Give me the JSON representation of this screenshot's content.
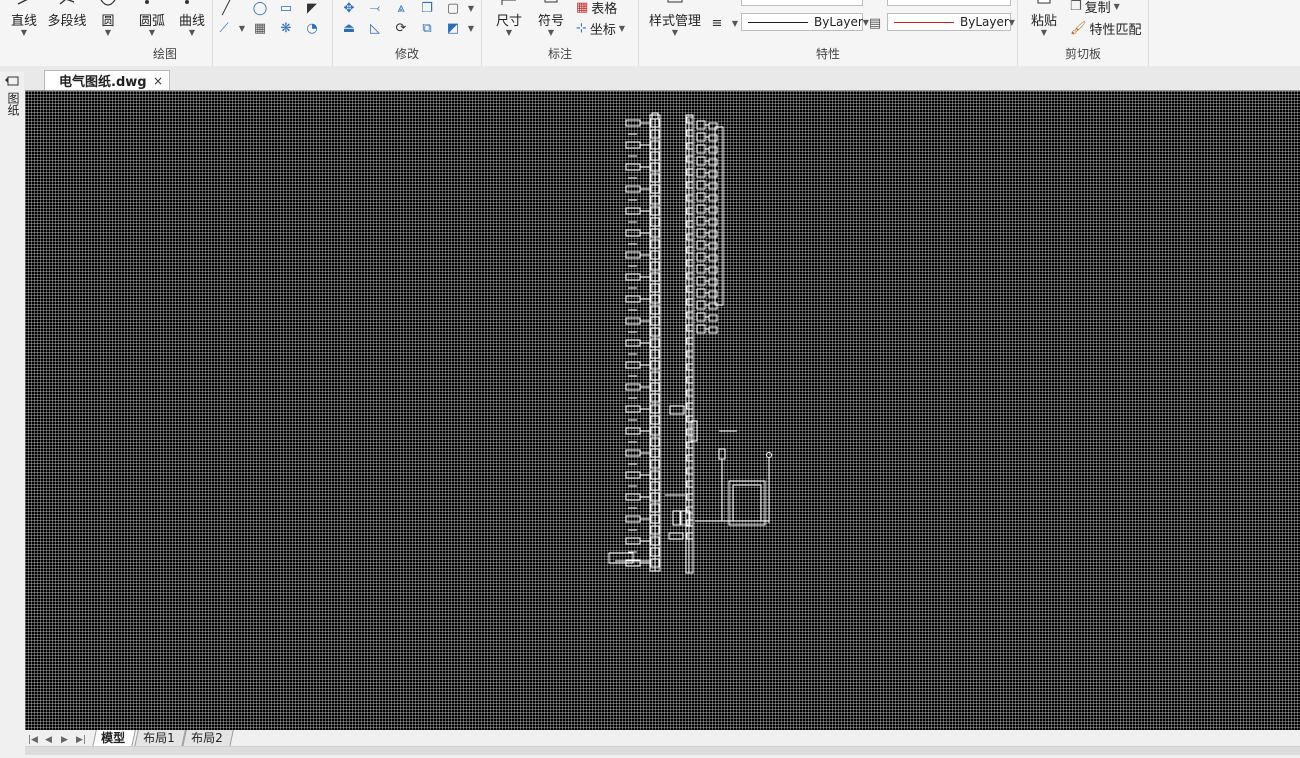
{
  "ribbon": {
    "draw": {
      "label": "绘图",
      "buttons": [
        "直线",
        "多段线",
        "圆",
        "圆弧",
        "曲线"
      ]
    },
    "modify": {
      "label": "修改"
    },
    "annotate": {
      "label": "标注",
      "dimension": "尺寸",
      "symbol": "符号",
      "table": "表格",
      "coordinate": "坐标"
    },
    "properties": {
      "label": "特性",
      "style_manager": "样式管理",
      "linetype": "ByLayer",
      "color": "ByLayer",
      "accent_red": "#d02020"
    },
    "clipboard": {
      "label": "剪切板",
      "paste": "粘贴",
      "copy": "复制",
      "match_props": "特性匹配"
    }
  },
  "document": {
    "tab_name": "电气图纸.dwg",
    "close": "×"
  },
  "side_panel": {
    "label": "图纸"
  },
  "layout_tabs": [
    "模型",
    "布局1",
    "布局2"
  ],
  "nav": [
    "|◀",
    "◀",
    "▶",
    "▶|"
  ]
}
